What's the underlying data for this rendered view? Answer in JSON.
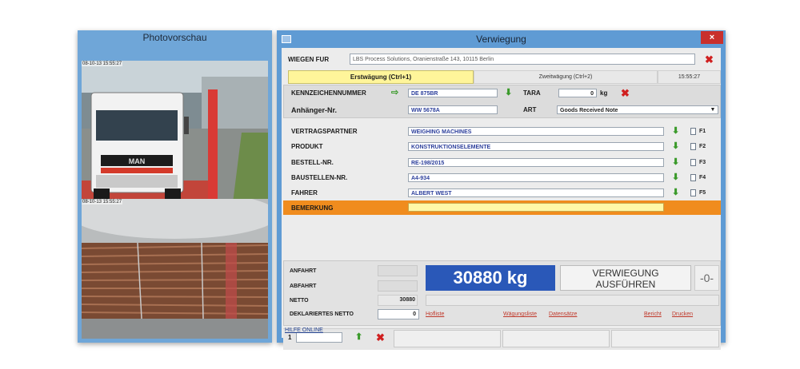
{
  "photo": {
    "title": "Photovorschau",
    "timestamp_top": "08-10-13 15:55:27",
    "timestamp_bottom": "08-10-13 15:55:27",
    "truck_brand": "MAN"
  },
  "window": {
    "title": "Verwiegung",
    "close": "×"
  },
  "wiegen_fur": {
    "label": "WIEGEN FUR",
    "value": "LBS Process Solutions, Oranienstraße 143, 10115 Berlin"
  },
  "tabs": {
    "first": "Erstwägung (Ctrl+1)",
    "second": "Zweitwägung (Ctrl+2)",
    "time": "15:55:27"
  },
  "vehicle": {
    "kennzeichen_label": "KENNZEICHENNUMMER",
    "kennzeichen_value": "DE 875BR",
    "tara_label": "TARA",
    "tara_value": "0",
    "tara_unit": "kg",
    "anhaenger_label": "Anhänger-Nr.",
    "anhaenger_value": "WW 5678A",
    "art_label": "ART",
    "art_value": "Goods Received Note"
  },
  "details": [
    {
      "label": "VERTRAGSPARTNER",
      "value": "WEIGHING MACHINES",
      "fkey": "F1"
    },
    {
      "label": "PRODUKT",
      "value": "KONSTRUKTIONSELEMENTE",
      "fkey": "F2"
    },
    {
      "label": "BESTELL-NR.",
      "value": "RE-198/2015",
      "fkey": "F3"
    },
    {
      "label": "BAUSTELLEN-NR.",
      "value": "A4-934",
      "fkey": "F4"
    },
    {
      "label": "FAHRER",
      "value": "ALBERT WEST",
      "fkey": "F5"
    }
  ],
  "bemerkung": {
    "label": "BEMERKUNG",
    "value": ""
  },
  "weights": {
    "anfahrt_label": "ANFAHRT",
    "abfahrt_label": "ABFAHRT",
    "netto_label": "NETTO",
    "netto_value": "30880",
    "deklariert_label": "DEKLARIERTES NETTO",
    "deklariert_value": "0",
    "display": "30880 kg",
    "button_line1": "VERWIEGUNG",
    "button_line2": "AUSFÜHREN",
    "status": "-0-"
  },
  "links": [
    "Hofliste",
    "Wägungsliste",
    "Datensätze",
    "Bericht",
    "Drucken"
  ],
  "footer": {
    "counter_label": "1",
    "help": "HILFE ONLINE"
  },
  "colors": {
    "accent_blue": "#2a58b8",
    "bemerkung_orange": "#f08c1e",
    "tab_active": "#fff59a",
    "title_blue": "#5f9bd4"
  }
}
